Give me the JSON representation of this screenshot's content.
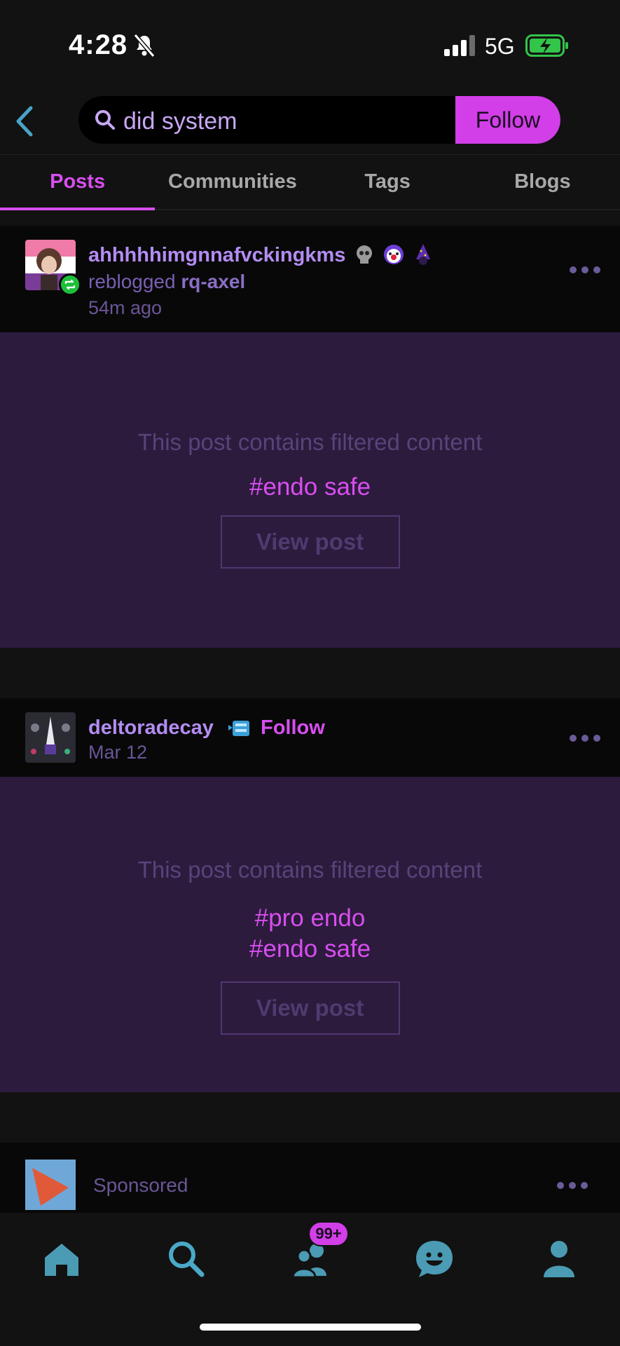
{
  "status_bar": {
    "time": "4:28",
    "network": "5G"
  },
  "search": {
    "query": "did system",
    "follow_label": "Follow"
  },
  "tabs": [
    {
      "label": "Posts",
      "active": true
    },
    {
      "label": "Communities",
      "active": false
    },
    {
      "label": "Tags",
      "active": false
    },
    {
      "label": "Blogs",
      "active": false
    }
  ],
  "posts": [
    {
      "blog": "ahhhhhimgnnafvckingkms",
      "reblogged_prefix": "reblogged",
      "reblogged_from": "rq-axel",
      "time": "54m ago",
      "filtered_message": "This post contains filtered content",
      "tags": [
        "#endo safe"
      ],
      "view_label": "View post"
    },
    {
      "blog": "deltoradecay",
      "follow_label": "Follow",
      "time": "Mar 12",
      "filtered_message": "This post contains filtered content",
      "tags": [
        "#pro endo",
        "#endo safe"
      ],
      "view_label": "View post"
    }
  ],
  "sponsored": {
    "label": "Sponsored"
  },
  "bottom_nav": {
    "items": [
      "home-icon",
      "search-icon",
      "communities-icon",
      "activity-icon",
      "account-icon"
    ],
    "communities_badge": "99+"
  },
  "colors": {
    "accent": "#d84ef0",
    "blog_name": "#b38cf2",
    "filtered_bg": "#2d1b3d",
    "nav_icon": "#4a9bb3"
  }
}
